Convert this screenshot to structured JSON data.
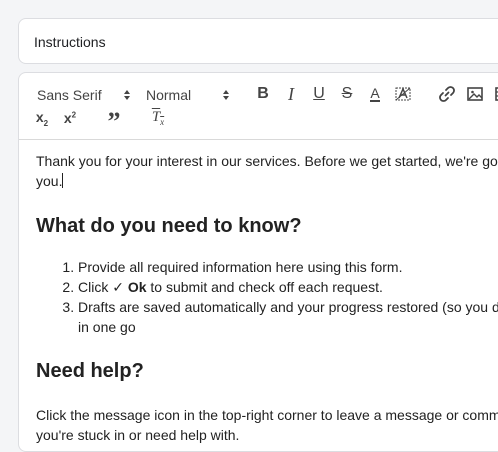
{
  "title_field": {
    "value": "Instructions"
  },
  "toolbar": {
    "font_family": "Sans Serif",
    "font_size": "Normal",
    "bold": "B",
    "italic": "I",
    "underline": "U",
    "strike": "S",
    "color": "A",
    "subscript": "x",
    "subscript_mark": "2",
    "superscript": "x",
    "superscript_mark": "2",
    "blockquote": "”",
    "clean": "T",
    "clean_mark": "x"
  },
  "content": {
    "intro_line1": "Thank you for your interest in our services. Before we get started, we're go",
    "intro_line2": "you.",
    "heading1": "What do you need to know?",
    "list": [
      {
        "text": "Provide all required information here using this form."
      },
      {
        "prefix": "Click ",
        "check": "✓ Ok",
        "suffix": " to submit and check off each request."
      },
      {
        "line1": "Drafts are saved automatically and your progress restored (so you d",
        "line2": "in one go"
      }
    ],
    "heading2": "Need help?",
    "help_line1": "Click the message icon in the top-right corner to leave a message or comm",
    "help_line2": "you're stuck in or need help with."
  }
}
